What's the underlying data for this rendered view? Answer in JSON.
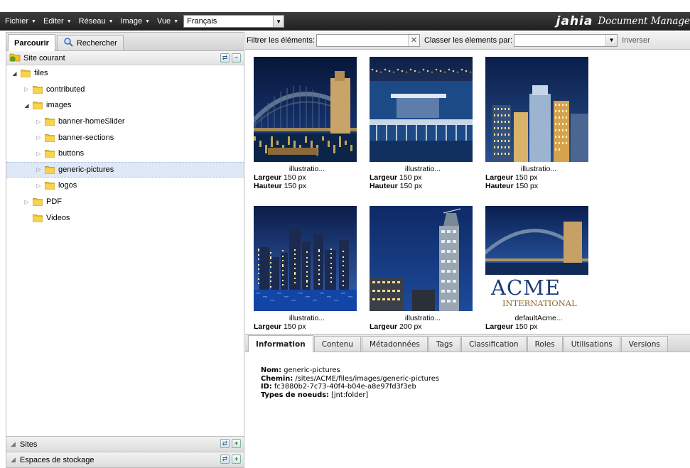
{
  "menubar": {
    "items": [
      {
        "label": "Fichier"
      },
      {
        "label": "Editer"
      },
      {
        "label": "Réseau"
      },
      {
        "label": "Image"
      },
      {
        "label": "Vue"
      }
    ],
    "language_value": "Français",
    "brand_logo": "jahia",
    "brand_title": "Document Manage"
  },
  "left_panel": {
    "tabs": [
      {
        "label": "Parcourir",
        "active": true
      },
      {
        "label": "Rechercher",
        "active": false
      }
    ],
    "section_title": "Site courant",
    "tree": [
      {
        "label": "files",
        "depth": 0,
        "expanded": true
      },
      {
        "label": "contributed",
        "depth": 1,
        "expanded": false
      },
      {
        "label": "images",
        "depth": 1,
        "expanded": true
      },
      {
        "label": "banner-homeSlider",
        "depth": 2,
        "expanded": false
      },
      {
        "label": "banner-sections",
        "depth": 2,
        "expanded": false
      },
      {
        "label": "buttons",
        "depth": 2,
        "expanded": false
      },
      {
        "label": "generic-pictures",
        "depth": 2,
        "expanded": false,
        "selected": true
      },
      {
        "label": "logos",
        "depth": 2,
        "expanded": false
      },
      {
        "label": "PDF",
        "depth": 1,
        "expanded": false
      },
      {
        "label": "Videos",
        "depth": 1,
        "leaf": true
      }
    ],
    "bottom_sections": [
      {
        "label": "Sites"
      },
      {
        "label": "Espaces de stockage"
      }
    ]
  },
  "toolbar": {
    "filter_label": "Filtrer les éléments:",
    "filter_value": "",
    "sort_label": "Classer les élements par:",
    "sort_value": "",
    "inverse_label": "Inverser"
  },
  "thumbnails": [
    {
      "caption": "illustratio...",
      "width_label": "Largeur",
      "width": "150 px",
      "height_label": "Hauteur",
      "height": "150 px",
      "scene": "bridge"
    },
    {
      "caption": "illustratio...",
      "width_label": "Largeur",
      "width": "150 px",
      "height_label": "Hauteur",
      "height": "150 px",
      "scene": "pier"
    },
    {
      "caption": "illustratio...",
      "width_label": "Largeur",
      "width": "150 px",
      "height_label": "Hauteur",
      "height": "150 px",
      "scene": "towers"
    },
    {
      "caption": "illustratio...",
      "width_label": "Largeur",
      "width": "150 px",
      "scene": "skyline"
    },
    {
      "caption": "illustratio...",
      "width_label": "Largeur",
      "width": "200 px",
      "scene": "tower"
    },
    {
      "caption": "defaultAcme...",
      "width_label": "Largeur",
      "width": "150 px",
      "scene": "acme",
      "logo_big": "ACME",
      "logo_small": "INTERNATIONAL"
    }
  ],
  "detail": {
    "tabs": [
      {
        "label": "Information",
        "active": true
      },
      {
        "label": "Contenu"
      },
      {
        "label": "Métadonnées"
      },
      {
        "label": "Tags"
      },
      {
        "label": "Classification"
      },
      {
        "label": "Roles"
      },
      {
        "label": "Utilisations"
      },
      {
        "label": "Versions"
      }
    ],
    "name_label": "Nom:",
    "name_value": "generic-pictures",
    "path_label": "Chemin:",
    "path_value": "/sites/ACME/files/images/generic-pictures",
    "id_label": "ID:",
    "id_value": "fc3880b2-7c73-40f4-b04e-a8e97fd3f3eb",
    "types_label": "Types de noeuds:",
    "types_value": "[jnt:folder]"
  },
  "colors": {
    "menubar": "#2b2b2b",
    "selection": "#dfe8f6",
    "folder": "#f2c322",
    "night_sky": "#0a1a3c"
  }
}
